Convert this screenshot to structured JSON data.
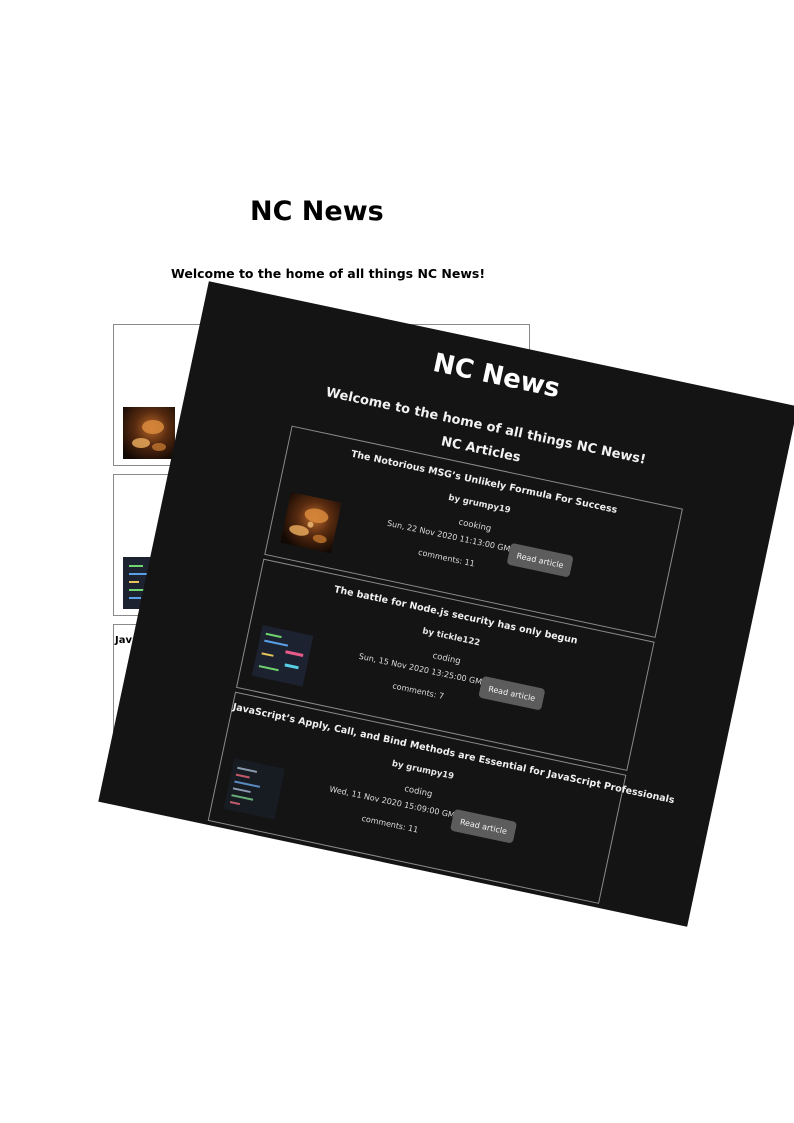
{
  "site": {
    "title": "NC News",
    "welcome": "Welcome to the home of all things NC News!",
    "articles_heading": "NC Articles"
  },
  "light_page": {
    "visible_card_title": "Java"
  },
  "articles": [
    {
      "title": "The Notorious MSG’s Unlikely Formula For Success",
      "author": "by grumpy19",
      "topic": "cooking",
      "date": "Sun, 22 Nov 2020 11:13:00 GMT",
      "comments": "comments: 11",
      "button": "Read article",
      "thumbnail_icon": "cooking-photo-icon"
    },
    {
      "title": "The battle for Node.js security has only begun",
      "author": "by tickle122",
      "topic": "coding",
      "date": "Sun, 15 Nov 2020 13:25:00 GMT",
      "comments": "comments: 7",
      "button": "Read article",
      "thumbnail_icon": "code-screen-photo-icon"
    },
    {
      "title": "JavaScript’s Apply, Call, and Bind Methods are Essential for JavaScript Professionals",
      "author": "by grumpy19",
      "topic": "coding",
      "date": "Wed, 11 Nov 2020 15:09:00 GMT",
      "comments": "comments: 11",
      "button": "Read article",
      "thumbnail_icon": "code-screen-photo-icon"
    }
  ],
  "colors": {
    "dark_background": "#141414",
    "button_background": "#5c5c5c",
    "card_border": "#8a8a8a"
  }
}
